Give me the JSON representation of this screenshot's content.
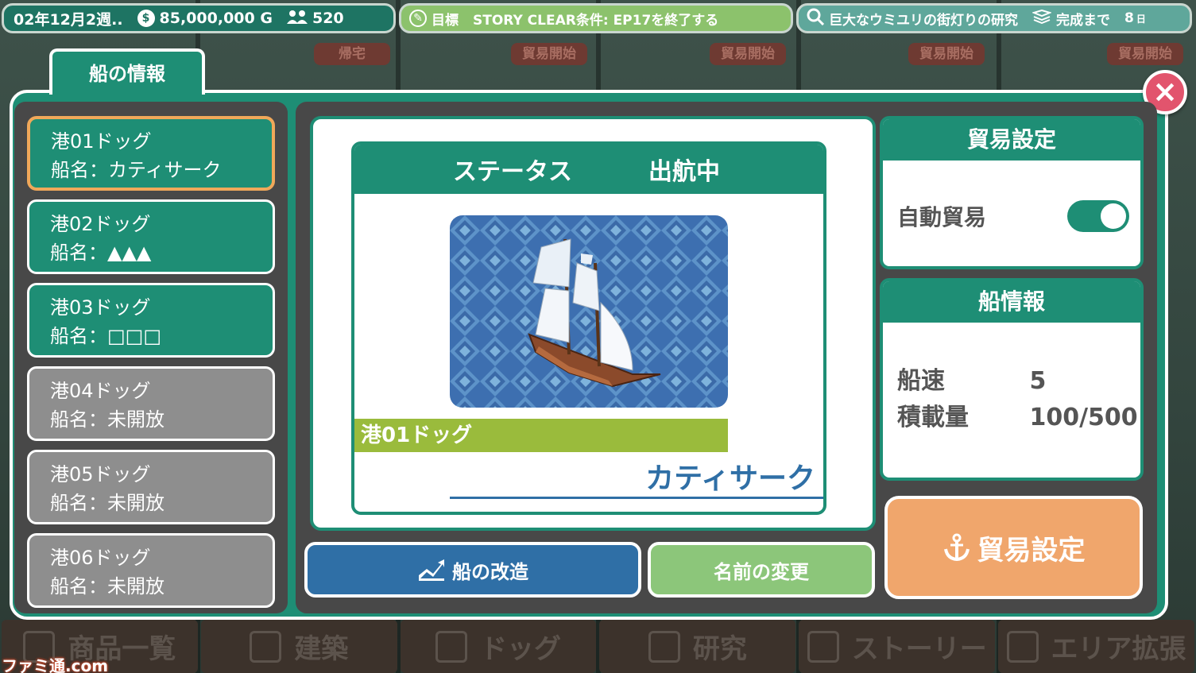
{
  "hud": {
    "date": "02年12月2週..",
    "money": "85,000,000 G",
    "population": "520",
    "goal_label": "目標",
    "goal_text": "STORY CLEAR条件: EP17を終了する",
    "research_text": "巨大なウミユリの街灯りの研究",
    "complete_label": "完成まで",
    "days_num": "8",
    "days_unit": "日"
  },
  "background": {
    "tags": [
      "帰宅",
      "貿易開始",
      "貿易開始",
      "貿易開始",
      "貿易開始"
    ]
  },
  "modal": {
    "title": "船の情報",
    "close": "×"
  },
  "docks": [
    {
      "line1": "港01ドッグ",
      "line2": "船名：カティサーク"
    },
    {
      "line1": "港02ドッグ",
      "line2": "船名：▲▲▲"
    },
    {
      "line1": "港03ドッグ",
      "line2": "船名：□□□"
    },
    {
      "line1": "港04ドッグ",
      "line2": "船名：未開放"
    },
    {
      "line1": "港05ドッグ",
      "line2": "船名：未開放"
    },
    {
      "line1": "港06ドッグ",
      "line2": "船名：未開放"
    }
  ],
  "status": {
    "label": "ステータス",
    "value": "出航中",
    "dock": "港01ドッグ",
    "ship_name": "カティサーク"
  },
  "buttons": {
    "upgrade": "船の改造",
    "rename": "名前の変更",
    "trade": "貿易設定"
  },
  "trade_settings": {
    "title": "貿易設定",
    "auto_trade_label": "自動貿易",
    "auto_trade_on": true
  },
  "ship_info": {
    "title": "船情報",
    "speed_label": "船速",
    "speed_value": "5",
    "cargo_label": "積載量",
    "cargo_value": "100/500"
  },
  "bottom_nav": [
    "商品一覧",
    "建築",
    "ドッグ",
    "研究",
    "ストーリー",
    "エリア拡張"
  ],
  "watermark": "ファミ通.com",
  "colors": {
    "teal": "#1e8e75",
    "blue": "#2f6fa6",
    "green": "#8cc67a",
    "orange": "#f0a66c",
    "olive": "#9abb3c",
    "close": "#e2546d",
    "selected_border": "#f0a85a"
  }
}
